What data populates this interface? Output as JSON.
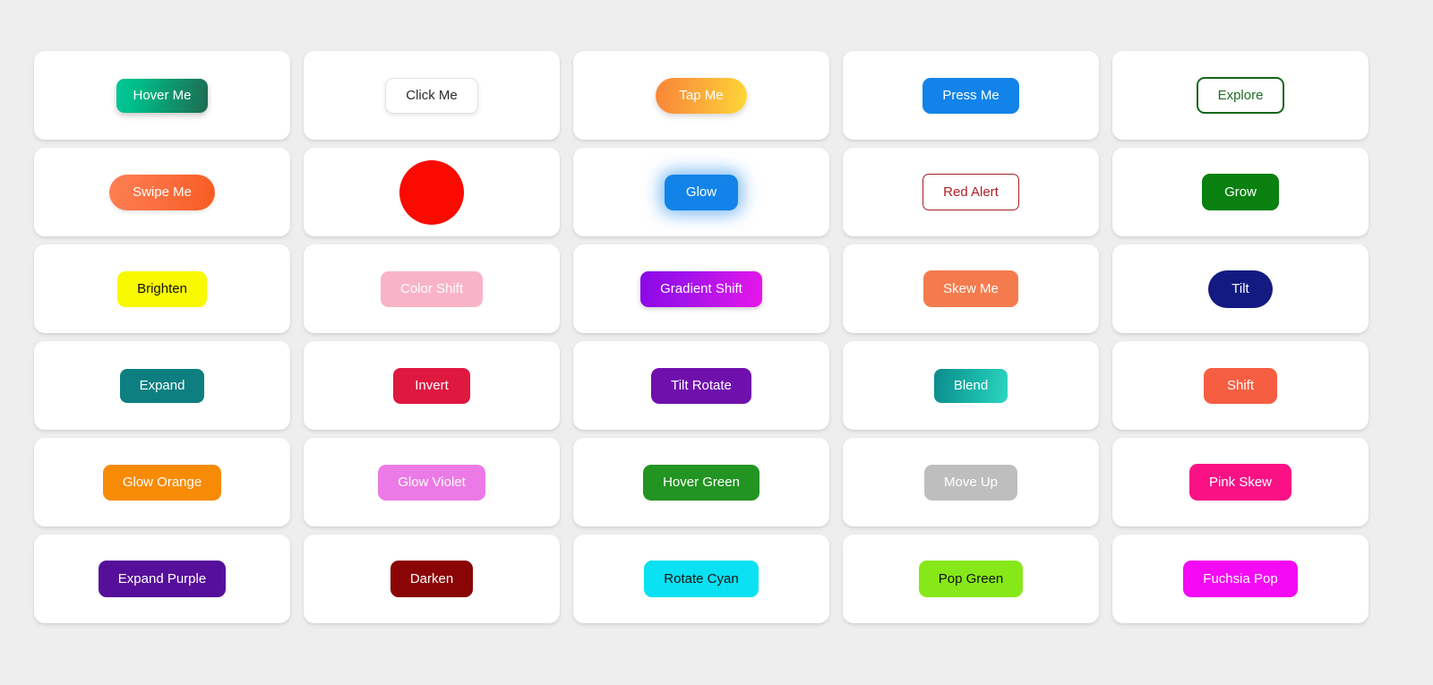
{
  "page": {
    "background_color": "#eeeeee",
    "card_background": "#ffffff",
    "columns": 5,
    "rows": 6
  },
  "buttons": [
    {
      "label": "Hover Me",
      "style": "b-hover-me",
      "effect": "gradient-sweep",
      "color": "#00c896",
      "text_color": "#ffffff"
    },
    {
      "label": "Click Me",
      "style": "b-click-me",
      "effect": "outline-lift",
      "color": "#ffffff",
      "text_color": "#2b2b2b"
    },
    {
      "label": "Tap Me",
      "style": "b-tap-me",
      "effect": "pill-gradient",
      "color": "#fba93a",
      "text_color": "#ffffff"
    },
    {
      "label": "Press Me",
      "style": "b-press-me",
      "effect": "press-down",
      "color": "#1283e8",
      "text_color": "#ffffff"
    },
    {
      "label": "Explore",
      "style": "b-explore",
      "effect": "outline-fill",
      "color": "#14661a",
      "text_color": "#1e6b22"
    },
    {
      "label": "Swipe Me",
      "style": "b-swipe-me",
      "effect": "slide",
      "color": "#fb6c3c",
      "text_color": "#ffffff"
    },
    {
      "label": "",
      "style": "b-shrink",
      "effect": "shrink-circle",
      "color": "#fa0a00",
      "text_color": "#333333"
    },
    {
      "label": "Glow",
      "style": "b-glow",
      "effect": "glow",
      "color": "#1283e8",
      "text_color": "#ffffff"
    },
    {
      "label": "Red Alert",
      "style": "b-red-alert",
      "effect": "outline-alert",
      "color": "#a51f24",
      "text_color": "#b02024"
    },
    {
      "label": "Grow",
      "style": "b-grow",
      "effect": "scale-up",
      "color": "#0a8011",
      "text_color": "#ffffff"
    },
    {
      "label": "Brighten",
      "style": "b-brighten",
      "effect": "brightness",
      "color": "#f9f900",
      "text_color": "#111111"
    },
    {
      "label": "Color Shift",
      "style": "b-color-shift",
      "effect": "hue-shift",
      "color": "#f8b4c6",
      "text_color": "#ffffff"
    },
    {
      "label": "Gradient Shift",
      "style": "b-gradient-shift",
      "effect": "gradient-shift",
      "color": "#a513ea",
      "text_color": "#ffffff"
    },
    {
      "label": "Skew Me",
      "style": "b-skew-me",
      "effect": "skew",
      "color": "#f47b4d",
      "text_color": "#ffffff"
    },
    {
      "label": "Tilt",
      "style": "b-tilt",
      "effect": "tilt",
      "color": "#131a82",
      "text_color": "#ffffff"
    },
    {
      "label": "Expand",
      "style": "b-expand",
      "effect": "expand",
      "color": "#0d7f80",
      "text_color": "#ffffff"
    },
    {
      "label": "Invert",
      "style": "b-invert",
      "effect": "invert",
      "color": "#df1840",
      "text_color": "#ffffff"
    },
    {
      "label": "Tilt Rotate",
      "style": "b-tilt-rotate",
      "effect": "tilt-rotate",
      "color": "#6f10ad",
      "text_color": "#ffffff"
    },
    {
      "label": "Blend",
      "style": "b-blend",
      "effect": "blend",
      "color": "#18b5a8",
      "text_color": "#ffffff"
    },
    {
      "label": "Shift",
      "style": "b-shift",
      "effect": "shift",
      "color": "#f65e42",
      "text_color": "#ffffff"
    },
    {
      "label": "Glow Orange",
      "style": "b-glow-orange",
      "effect": "glow-orange",
      "color": "#f78b06",
      "text_color": "#ffffff"
    },
    {
      "label": "Glow Violet",
      "style": "b-glow-violet",
      "effect": "glow-violet",
      "color": "#ec7ae6",
      "text_color": "#ffffff"
    },
    {
      "label": "Hover Green",
      "style": "b-hover-green",
      "effect": "hover-green",
      "color": "#229422",
      "text_color": "#ffffff"
    },
    {
      "label": "Move Up",
      "style": "b-move-up",
      "effect": "translate-up",
      "color": "#bebebe",
      "text_color": "#ffffff"
    },
    {
      "label": "Pink Skew",
      "style": "b-pink-skew",
      "effect": "pink-skew",
      "color": "#fa1285",
      "text_color": "#ffffff"
    },
    {
      "label": "Expand Purple",
      "style": "b-expand-purple",
      "effect": "expand-purple",
      "color": "#560f9a",
      "text_color": "#ffffff"
    },
    {
      "label": "Darken",
      "style": "b-darken",
      "effect": "darken",
      "color": "#8a0606",
      "text_color": "#ffffff"
    },
    {
      "label": "Rotate Cyan",
      "style": "b-rotate-cyan",
      "effect": "rotate-cyan",
      "color": "#0ae1f2",
      "text_color": "#111111"
    },
    {
      "label": "Pop Green",
      "style": "b-pop-green",
      "effect": "pop-green",
      "color": "#86e818",
      "text_color": "#111111"
    },
    {
      "label": "Fuchsia Pop",
      "style": "b-fuchsia-pop",
      "effect": "fuchsia-pop",
      "color": "#f40af4",
      "text_color": "#ffffff"
    }
  ]
}
